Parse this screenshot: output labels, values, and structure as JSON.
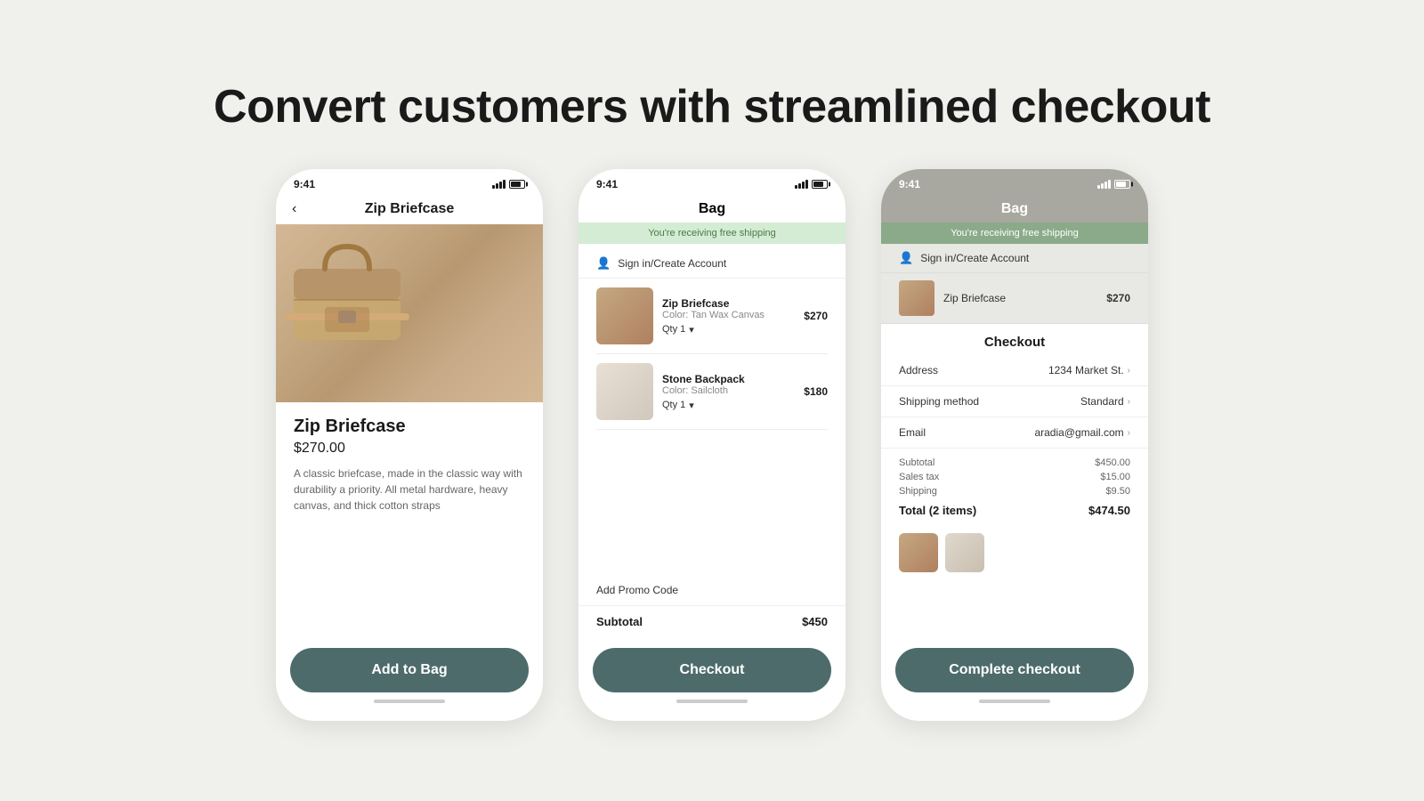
{
  "headline": "Convert customers with streamlined checkout",
  "phones": [
    {
      "id": "phone1",
      "status_time": "9:41",
      "nav_title": "Zip Briefcase",
      "product": {
        "name": "Zip Briefcase",
        "price": "$270.00",
        "description": "A classic briefcase, made in the classic way with durability a priority. All metal hardware, heavy canvas, and thick cotton straps"
      },
      "button_label": "Add to Bag"
    },
    {
      "id": "phone2",
      "status_time": "9:41",
      "screen_title": "Bag",
      "free_shipping_text": "You're receiving free shipping",
      "sign_in_text": "Sign in/Create Account",
      "items": [
        {
          "name": "Zip Briefcase",
          "color": "Color: Tan Wax Canvas",
          "qty": "Qty 1",
          "price": "$270"
        },
        {
          "name": "Stone Backpack",
          "color": "Color: Sailcloth",
          "qty": "Qty 1",
          "price": "$180"
        }
      ],
      "promo_label": "Add Promo Code",
      "subtotal_label": "Subtotal",
      "subtotal_value": "$450",
      "button_label": "Checkout"
    },
    {
      "id": "phone3",
      "status_time": "9:41",
      "screen_title": "Bag",
      "free_shipping_text": "You're receiving free shipping",
      "sign_in_text": "Sign in/Create Account",
      "mini_item_name": "Zip Briefcase",
      "mini_item_price": "$270",
      "checkout": {
        "title": "Checkout",
        "address_label": "Address",
        "address_value": "1234 Market St.",
        "shipping_label": "Shipping method",
        "shipping_value": "Standard",
        "email_label": "Email",
        "email_value": "aradia@gmail.com",
        "subtotal_label": "Subtotal",
        "subtotal_value": "$450.00",
        "tax_label": "Sales tax",
        "tax_value": "$15.00",
        "shipping_cost_label": "Shipping",
        "shipping_cost_value": "$9.50",
        "total_label": "Total (2 items)",
        "total_value": "$474.50"
      },
      "button_label": "Complete checkout"
    }
  ]
}
